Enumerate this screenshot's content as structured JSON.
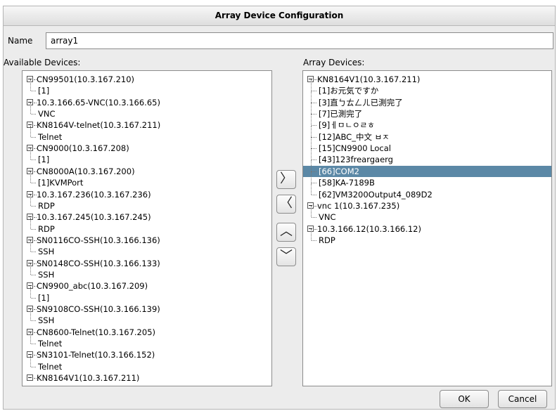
{
  "window": {
    "title": "Array Device Configuration"
  },
  "name_field": {
    "label": "Name",
    "value": "array1"
  },
  "available": {
    "label": "Available Devices:",
    "tree": [
      {
        "text": "CN99501(10.3.167.210)",
        "level": 0
      },
      {
        "text": "[1]",
        "level": 1
      },
      {
        "text": "10.3.166.65-VNC(10.3.166.65)",
        "level": 0
      },
      {
        "text": "VNC",
        "level": 1
      },
      {
        "text": "KN8164V-telnet(10.3.167.211)",
        "level": 0
      },
      {
        "text": "Telnet",
        "level": 1
      },
      {
        "text": "CN9000(10.3.167.208)",
        "level": 0
      },
      {
        "text": "[1]",
        "level": 1
      },
      {
        "text": "CN8000A(10.3.167.200)",
        "level": 0
      },
      {
        "text": "[1]KVMPort",
        "level": 1
      },
      {
        "text": "10.3.167.236(10.3.167.236)",
        "level": 0
      },
      {
        "text": "RDP",
        "level": 1
      },
      {
        "text": "10.3.167.245(10.3.167.245)",
        "level": 0
      },
      {
        "text": "RDP",
        "level": 1
      },
      {
        "text": "SN0116CO-SSH(10.3.166.136)",
        "level": 0
      },
      {
        "text": "SSH",
        "level": 1
      },
      {
        "text": "SN0148CO-SSH(10.3.166.133)",
        "level": 0
      },
      {
        "text": "SSH",
        "level": 1
      },
      {
        "text": "CN9900_abc(10.3.167.209)",
        "level": 0
      },
      {
        "text": "[1]",
        "level": 1
      },
      {
        "text": "SN9108CO-SSH(10.3.166.139)",
        "level": 0
      },
      {
        "text": "SSH",
        "level": 1
      },
      {
        "text": "CN8600-Telnet(10.3.167.205)",
        "level": 0
      },
      {
        "text": "Telnet",
        "level": 1
      },
      {
        "text": "SN3101-Telnet(10.3.166.152)",
        "level": 0
      },
      {
        "text": "Telnet",
        "level": 1
      },
      {
        "text": "KN8164V1(10.3.167.211)",
        "level": 0
      }
    ],
    "scroll_position": 0.06,
    "scroll_visible_fraction": 0.94
  },
  "array": {
    "label": "Array Devices:",
    "tree": [
      {
        "text": "KN8164V1(10.3.167.211)",
        "level": 0
      },
      {
        "text": "[1]お元気ですか",
        "level": 1
      },
      {
        "text": "[3]直ㄅㄊㄥㄦ已測完了",
        "level": 1
      },
      {
        "text": "[7]已測完了",
        "level": 1
      },
      {
        "text": "[9]ㅔㅁㄴㅇㄹㅎ",
        "level": 1
      },
      {
        "text": "[12]ABC_中文 ㅂㅈ",
        "level": 1
      },
      {
        "text": "[15]CN9900 Local",
        "level": 1
      },
      {
        "text": "[43]123freargaerg",
        "level": 1
      },
      {
        "text": "[66]COM2",
        "level": 1,
        "selected": true
      },
      {
        "text": "[58]KA-7189B",
        "level": 1
      },
      {
        "text": "[62]VM3200Output4_089D2",
        "level": 1
      },
      {
        "text": "vnc 1(10.3.167.235)",
        "level": 0
      },
      {
        "text": "VNC",
        "level": 1
      },
      {
        "text": "10.3.166.12(10.3.166.12)",
        "level": 0
      },
      {
        "text": "RDP",
        "level": 1
      }
    ]
  },
  "transfer_buttons": {
    "add": "〉",
    "remove": "〈",
    "move_up": "︿",
    "move_down": "﹀"
  },
  "footer": {
    "ok": "OK",
    "cancel": "Cancel"
  },
  "colors": {
    "selection": "#5b88a6",
    "background": "#ececec"
  }
}
